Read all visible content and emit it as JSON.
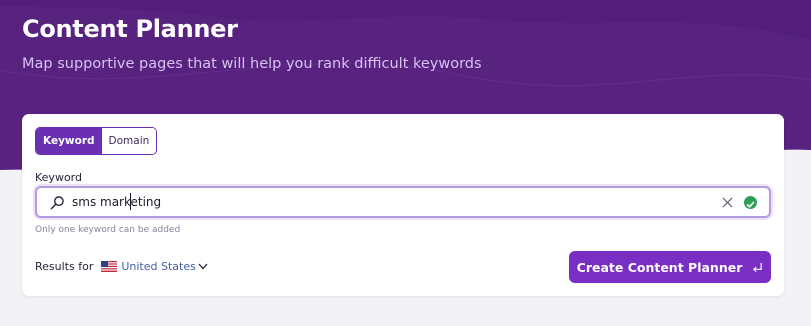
{
  "header": {
    "title": "Content Planner",
    "subtitle": "Map supportive pages that will help you rank difficult keywords"
  },
  "mode_toggle": {
    "options": [
      "Keyword",
      "Domain"
    ],
    "selected": "Keyword"
  },
  "keyword_field": {
    "label": "Keyword",
    "value": "sms marketing",
    "helper": "Only one keyword can be added",
    "icons": [
      "search-icon",
      "clear-icon",
      "valid-check-icon"
    ]
  },
  "results_for": {
    "label": "Results for",
    "country": "United States",
    "flag": "us-flag-icon"
  },
  "cta": {
    "label": "Create Content Planner",
    "icon": "enter-icon"
  },
  "colors": {
    "header_bg": "#5b2288",
    "primary": "#7a2fc4",
    "toggle_active": "#6b2fb3",
    "success": "#2f9e57"
  }
}
